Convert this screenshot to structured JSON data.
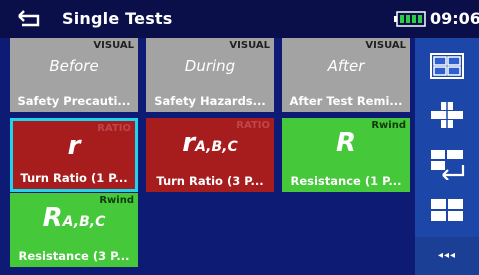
{
  "header": {
    "title": "Single Tests",
    "time": "09:06",
    "back_icon": "back-arrow-icon",
    "battery_icon": "battery-full-icon"
  },
  "tiles": [
    {
      "tag": "VISUAL",
      "main": "Before",
      "name": "Safety Precauti...",
      "type": "visual"
    },
    {
      "tag": "VISUAL",
      "main": "During",
      "name": "Safety Hazards...",
      "type": "visual"
    },
    {
      "tag": "VISUAL",
      "main": "After",
      "name": "After Test Remi...",
      "type": "visual"
    },
    {
      "tag": "RATIO",
      "symbol": "r",
      "subscript": "",
      "name": "Turn Ratio (1 P...",
      "type": "ratio",
      "selected": true
    },
    {
      "tag": "RATIO",
      "symbol": "r",
      "subscript": "A,B,C",
      "name": "Turn Ratio (3 P...",
      "type": "ratio"
    },
    {
      "tag": "Rwind",
      "symbol": "R",
      "subscript": "",
      "name": "Resistance (1 P...",
      "type": "rwind"
    },
    {
      "tag": "Rwind",
      "symbol": "R",
      "subscript": "A,B,C",
      "name": "Resistance (3 P...",
      "type": "rwind"
    }
  ],
  "sidebar": {
    "buttons": [
      "grid-view-icon",
      "expand-view-icon",
      "swap-layout-icon",
      "tile-layout-icon"
    ],
    "more_label": "◂◂◂"
  },
  "colors": {
    "visual": "#a3a3a3",
    "ratio": "#a71d1d",
    "rwind": "#45c83a",
    "selected_border": "#22d3ee",
    "background": "#0d1b75",
    "sidebar": "#1c47a8"
  }
}
